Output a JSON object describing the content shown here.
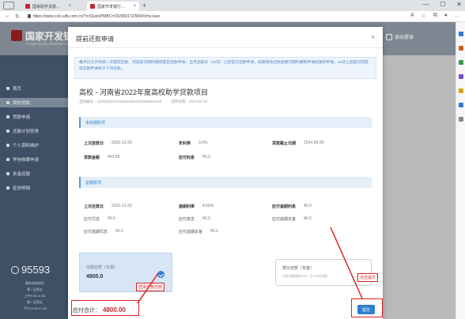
{
  "browser": {
    "tabs": [
      {
        "label": "国家助学贷款…"
      },
      {
        "label": "国家开发银行…"
      }
    ],
    "new_tab": "+",
    "url": "https://www.csls.cdb.com.cn/?rc/QuickPMBC=/15/999172/969/#/my-loan",
    "controls": {
      "minimize": "—",
      "maximize": "☐",
      "close": "✕"
    }
  },
  "header": {
    "logo_cn": "国家开发银",
    "logo_en": "CHINA DEVELOPMENT BANK",
    "logout": "退出登录"
  },
  "sidenav": {
    "items": [
      {
        "label": "首页"
      },
      {
        "label": "我的贷款"
      },
      {
        "label": "贷款申请"
      },
      {
        "label": "还款计划安排"
      },
      {
        "label": "个人资料维护"
      },
      {
        "label": "学信档案申请"
      },
      {
        "label": "本金还款"
      },
      {
        "label": "征信明细"
      }
    ],
    "hotline": "95593",
    "hotline_info": [
      "服务热线电话",
      "周一至周五",
      "上午8:30-11:30",
      "周一至周五",
      "下午13:30-17:00"
    ]
  },
  "modal": {
    "title": "提前还款申请",
    "close": "×",
    "notice": "每月仅允许完成一次提前还款，完成前可随时撤销提前还款申请，当月还款日（15日）之前提交还款申请，如需修改还款金额可随时撤销申请后重新申请，15日之后提交的提前还款申请将于下月还款。",
    "project": {
      "title": "高校 - 河南省2022年度高校助学贷款项目",
      "contract_label": "合同编号：",
      "contract_no": "411025020114348419520200306013645",
      "date_label": "还款日期：",
      "date": "2024-02-20"
    },
    "section_unexpired": "未到期款项",
    "unexpired": {
      "loan_date_label": "上次放款日",
      "loan_date": "2023-12-20",
      "rate_label": "年利率",
      "rate": "3.6%",
      "due_label": "贷款截止日期",
      "due": "2024-06-30",
      "amount_label": "贷款金额",
      "amount": "¥43.68",
      "interest_label": "应付利息",
      "interest": "¥0.0"
    },
    "section_overdue": "逾期款项",
    "overdue": {
      "last_date_label": "上次还款日",
      "last_date": "2023-12-20",
      "odue_rate_label": "逾期利率",
      "odue_rate": "4.68%",
      "odue_int_label": "应付逾期利息",
      "odue_int": "¥0.0",
      "pay_odue_label": "应付罚息",
      "pay_odue": "¥0.0",
      "pen_label": "应付复息",
      "pen": "¥0.0",
      "odue_prin_label": "应付逾期本金",
      "odue_prin": "¥0.0",
      "x1_label": "应付逾期罚息",
      "x1": "¥0.0",
      "x2_label": "应付逾期本金",
      "x2": "¥0.0"
    },
    "option_full": {
      "label": "全额还款（本金）",
      "amount": "4800.0"
    },
    "option_partial": {
      "label": "部分还款（本金）",
      "sub": "还款金额最低500，且100的倍数"
    },
    "total_label": "应付合计：",
    "total_value": "4800.00",
    "submit": "提交"
  },
  "annotations": {
    "select_full": "选择全额还款",
    "click_submit": "点击提交"
  },
  "colors": {
    "accent": "#2f7fd0",
    "annotation": "#e02020",
    "nav_bg": "#3f5066",
    "brand": "#c1272d"
  }
}
